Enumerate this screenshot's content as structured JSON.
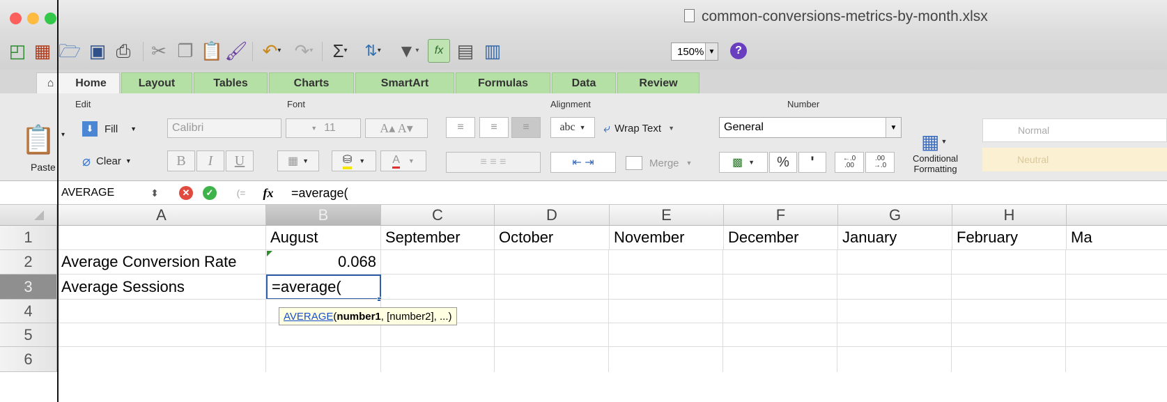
{
  "window": {
    "title": "common-conversions-metrics-by-month.xlsx"
  },
  "toolbar": {
    "zoom": "150%"
  },
  "tabs": [
    "Home",
    "Layout",
    "Tables",
    "Charts",
    "SmartArt",
    "Formulas",
    "Data",
    "Review"
  ],
  "ribbon": {
    "edit": {
      "label": "Edit",
      "fill": "Fill",
      "clear": "Clear",
      "paste": "Paste"
    },
    "font": {
      "label": "Font",
      "name": "Calibri",
      "size": "11",
      "bold": "B",
      "italic": "I",
      "underline": "U"
    },
    "alignment": {
      "label": "Alignment",
      "wrap_text": "Wrap Text",
      "merge": "Merge",
      "abc": "abc"
    },
    "number": {
      "label": "Number",
      "format": "General",
      "percent": "%",
      "comma": "'",
      "inc_decimal_top": "←.0",
      "inc_decimal_bottom": ".00",
      "dec_decimal_top": ".00",
      "dec_decimal_bottom": "→.0"
    },
    "conditional_formatting": {
      "line1": "Conditional",
      "line2": "Formatting"
    },
    "styles": {
      "normal": "Normal",
      "neutral": "Neutral"
    }
  },
  "formula_bar": {
    "name_box": "AVERAGE",
    "fx": "fx",
    "formula": "=average("
  },
  "columns": [
    "A",
    "B",
    "C",
    "D",
    "E",
    "F",
    "G",
    "H",
    "Ma"
  ],
  "rows": [
    "1",
    "2",
    "3",
    "4",
    "5",
    "6"
  ],
  "cells": {
    "r1": [
      "",
      "August",
      "September",
      "October",
      "November",
      "December",
      "January",
      "February",
      "Ma"
    ],
    "r2": [
      "Average Conversion Rate",
      "0.068"
    ],
    "r3": [
      "Average Sessions",
      "=average("
    ]
  },
  "tooltip": {
    "func": "AVERAGE",
    "arg1": "number1",
    "rest": ", [number2], ...)"
  },
  "colors": {
    "accent": "#2c5fa8",
    "tab_green": "#b4e0a6",
    "close": "#fc605c",
    "minimize": "#fdbc40",
    "zoom": "#34c84a"
  }
}
